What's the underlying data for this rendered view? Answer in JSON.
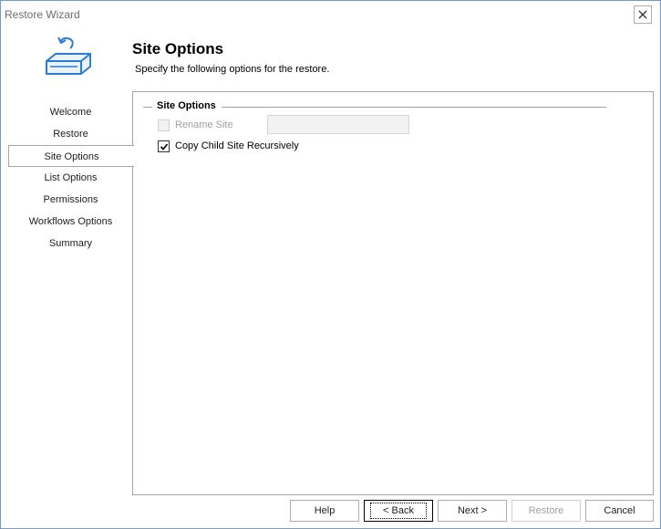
{
  "window": {
    "title": "Restore Wizard"
  },
  "header": {
    "title": "Site Options",
    "subtitle": "Specify the following options for the restore."
  },
  "nav": {
    "items": [
      {
        "label": "Welcome"
      },
      {
        "label": "Restore"
      },
      {
        "label": "Site Options",
        "active": true
      },
      {
        "label": "List Options"
      },
      {
        "label": "Permissions"
      },
      {
        "label": "Workflows Options"
      },
      {
        "label": "Summary"
      }
    ]
  },
  "site_options": {
    "group_title": "Site Options",
    "rename_site": {
      "label": "Rename Site",
      "checked": false,
      "enabled": false,
      "value": ""
    },
    "copy_child": {
      "label": "Copy Child Site Recursively",
      "checked": true,
      "enabled": true
    }
  },
  "buttons": {
    "help": "Help",
    "back": "< Back",
    "next": "Next >",
    "restore": "Restore",
    "cancel": "Cancel"
  },
  "colors": {
    "accent": "#2b7cd3",
    "border": "#a6a6a6"
  },
  "icons": {
    "close": "close-icon",
    "wizard": "restore-wizard-icon",
    "check": "checkmark-icon"
  }
}
